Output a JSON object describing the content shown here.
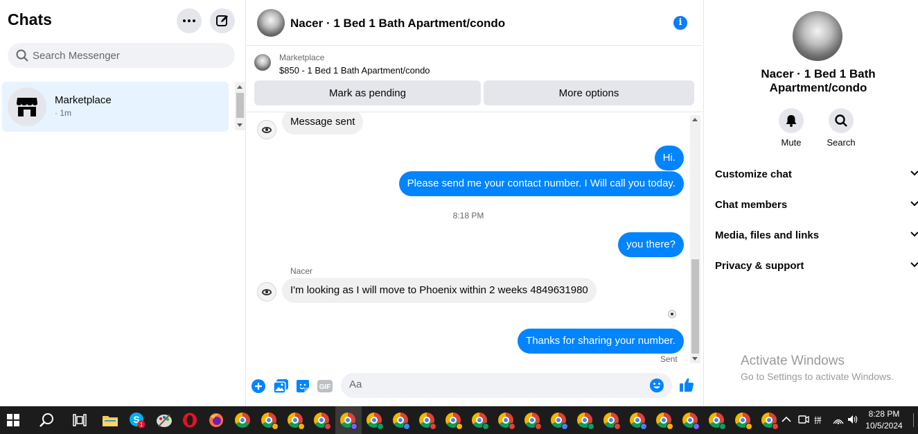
{
  "sidebar": {
    "title": "Chats",
    "search_placeholder": "Search Messenger",
    "conversations": [
      {
        "name": "Marketplace",
        "time": "· 1m"
      }
    ]
  },
  "chat": {
    "header_title": "Nacer · 1 Bed 1 Bath Apartment/condo",
    "marketplace_label": "Marketplace",
    "listing": "$850 - 1 Bed 1 Bath Apartment/condo",
    "mark_pending": "Mark as pending",
    "more_options": "More options",
    "messages": [
      {
        "from": "them",
        "text": "Message sent"
      },
      {
        "from": "me",
        "text": "Hi."
      },
      {
        "from": "me",
        "text": "Please send me your contact number. I Will call you today."
      },
      {
        "from": "me",
        "text": "you there?"
      },
      {
        "from": "them",
        "text": "I'm looking as I will move to Phoenix within 2 weeks 4849631980"
      },
      {
        "from": "me",
        "text": "Thanks for sharing your number."
      }
    ],
    "timestamp": "8:18 PM",
    "sender_name": "Nacer",
    "sent_status": "Sent",
    "composer_placeholder": "Aa",
    "gif_label": "GIF"
  },
  "details": {
    "title": "Nacer · 1 Bed 1 Bath Apartment/condo",
    "mute": "Mute",
    "search": "Search",
    "sections": [
      "Customize chat",
      "Chat members",
      "Media, files and links",
      "Privacy & support"
    ]
  },
  "watermark": {
    "line1": "Activate Windows",
    "line2": "Go to Settings to activate Windows."
  },
  "taskbar": {
    "time": "8:28 PM",
    "date": "10/5/2024",
    "skype_badge": "1",
    "chrome_profile_colors": [
      "#f4b400",
      "#f4b400",
      "#db4437",
      "#7b61ff",
      "#0f9d58",
      "#4285f4",
      "#db4437",
      "#f4b400",
      "#0f9d58",
      "#db4437",
      "#db4437",
      "#4285f4",
      "#0f9d58",
      "#db4437",
      "#4285f4",
      "#f4b400",
      "#7b61ff",
      "#0f9d58",
      "#f4b400",
      "#db4437"
    ]
  },
  "colors": {
    "accent": "#0084ff",
    "info": "#0a7cff"
  }
}
